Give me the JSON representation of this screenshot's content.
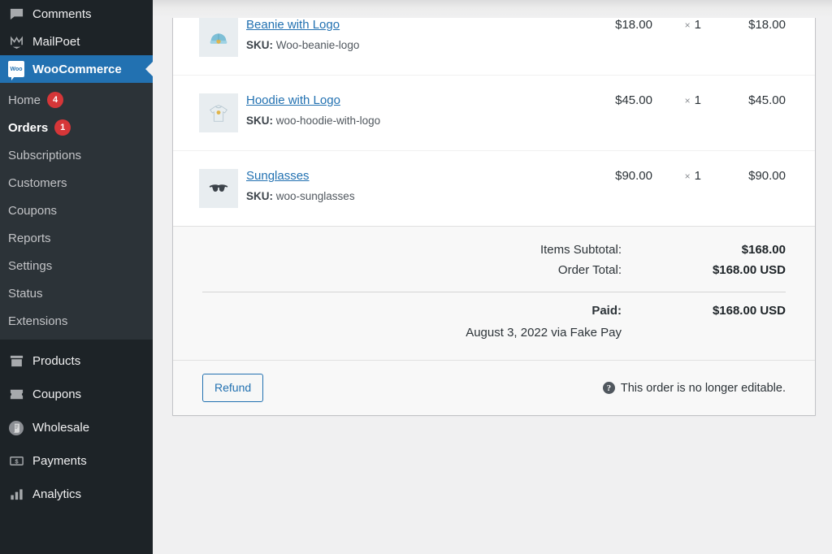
{
  "sidebar": {
    "top_items": [
      {
        "label": "Comments",
        "icon": "comments-icon"
      },
      {
        "label": "MailPoet",
        "icon": "mailpoet-icon"
      },
      {
        "label": "WooCommerce",
        "icon": "woocommerce-icon",
        "current": true
      }
    ],
    "submenu": [
      {
        "label": "Home",
        "badge": "4",
        "active": false
      },
      {
        "label": "Orders",
        "badge": "1",
        "active": true
      },
      {
        "label": "Subscriptions",
        "badge": "",
        "active": false
      },
      {
        "label": "Customers",
        "badge": "",
        "active": false
      },
      {
        "label": "Coupons",
        "badge": "",
        "active": false
      },
      {
        "label": "Reports",
        "badge": "",
        "active": false
      },
      {
        "label": "Settings",
        "badge": "",
        "active": false
      },
      {
        "label": "Status",
        "badge": "",
        "active": false
      },
      {
        "label": "Extensions",
        "badge": "",
        "active": false
      }
    ],
    "bottom_items": [
      {
        "label": "Products",
        "icon": "products-box-icon"
      },
      {
        "label": "Coupons",
        "icon": "coupon-ticket-icon"
      },
      {
        "label": "Wholesale",
        "icon": "wholesale-scroll-icon"
      },
      {
        "label": "Payments",
        "icon": "payments-banknote-icon"
      },
      {
        "label": "Analytics",
        "icon": "analytics-bars-icon"
      }
    ]
  },
  "order_items": [
    {
      "name": "Beanie with Logo",
      "sku_label": "SKU:",
      "sku": "Woo-beanie-logo",
      "cost": "$18.00",
      "qty_sign": "×",
      "qty": "1",
      "total": "$18.00",
      "thumb_icon": "beanie-thumbnail"
    },
    {
      "name": "Hoodie with Logo",
      "sku_label": "SKU:",
      "sku": "woo-hoodie-with-logo",
      "cost": "$45.00",
      "qty_sign": "×",
      "qty": "1",
      "total": "$45.00",
      "thumb_icon": "hoodie-thumbnail"
    },
    {
      "name": "Sunglasses",
      "sku_label": "SKU:",
      "sku": "woo-sunglasses",
      "cost": "$90.00",
      "qty_sign": "×",
      "qty": "1",
      "total": "$90.00",
      "thumb_icon": "sunglasses-thumbnail"
    }
  ],
  "totals": {
    "items_subtotal_label": "Items Subtotal:",
    "items_subtotal_value": "$168.00",
    "order_total_label": "Order Total:",
    "order_total_value": "$168.00 USD",
    "paid_label": "Paid:",
    "paid_value": "$168.00 USD",
    "paid_note": "August 3, 2022 via Fake Pay"
  },
  "footer": {
    "refund_label": "Refund",
    "note_text": "This order is no longer editable.",
    "help_glyph": "?"
  },
  "colors": {
    "admin_bg": "#1d2327",
    "submenu_bg": "#2c3338",
    "accent_blue": "#2271b1",
    "badge_red": "#d63638",
    "panel_bg": "#ffffff",
    "totals_bg": "#f8f8f8"
  }
}
